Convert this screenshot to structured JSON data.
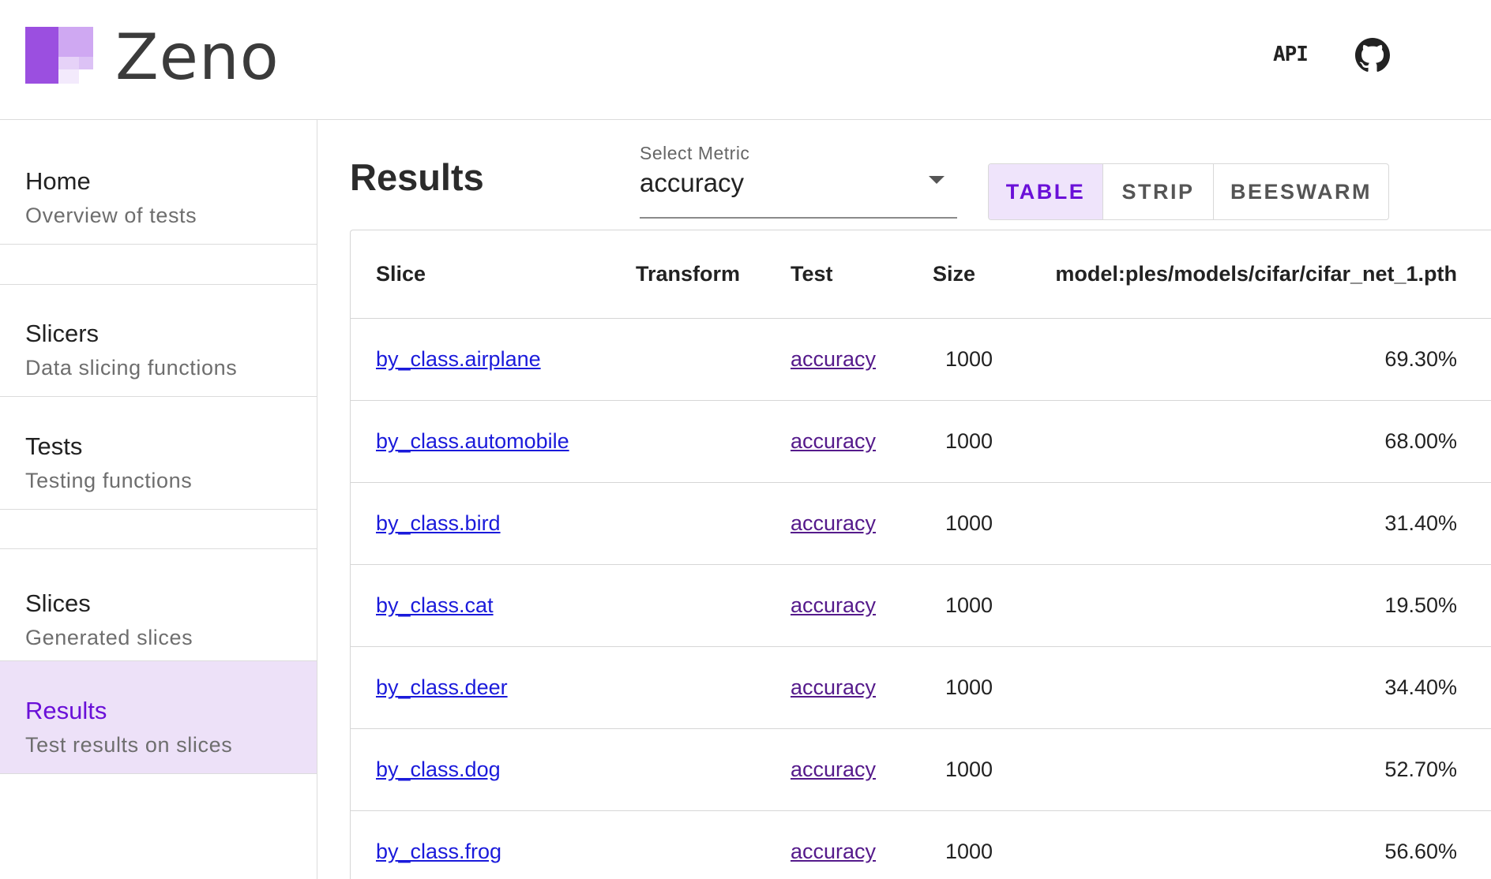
{
  "header": {
    "app_name": "Zeno",
    "api_label": "API",
    "icons": {
      "logo": "zeno-logo",
      "github": "github-icon"
    },
    "colors": {
      "brand": "#9b4fe0",
      "brand_light": "#cfa8f2"
    }
  },
  "sidebar": {
    "items": [
      {
        "title": "Home",
        "subtitle": "Overview of tests",
        "active": false
      },
      {
        "title": "Slicers",
        "subtitle": "Data slicing functions",
        "active": false
      },
      {
        "title": "Tests",
        "subtitle": "Testing functions",
        "active": false
      },
      {
        "title": "Slices",
        "subtitle": "Generated slices",
        "active": false
      },
      {
        "title": "Results",
        "subtitle": "Test results on slices",
        "active": true
      }
    ],
    "colors": {
      "active_bg": "#ede1f8",
      "active_text": "#6a10d8"
    }
  },
  "main": {
    "title": "Results",
    "metric_select": {
      "label": "Select Metric",
      "value": "accuracy"
    },
    "view_tabs": [
      {
        "label": "TABLE",
        "active": true
      },
      {
        "label": "STRIP",
        "active": false
      },
      {
        "label": "BEESWARM",
        "active": false
      }
    ],
    "table": {
      "columns": {
        "slice": "Slice",
        "transform": "Transform",
        "test": "Test",
        "size": "Size",
        "model_prefix": "model",
        "model_rest": ":ples/models/cifar/cifar_net_1.pth"
      },
      "rows": [
        {
          "slice": "by_class.airplane",
          "transform": "",
          "test": "accuracy",
          "size": "1000",
          "value": "69.30%"
        },
        {
          "slice": "by_class.automobile",
          "transform": "",
          "test": "accuracy",
          "size": "1000",
          "value": "68.00%"
        },
        {
          "slice": "by_class.bird",
          "transform": "",
          "test": "accuracy",
          "size": "1000",
          "value": "31.40%"
        },
        {
          "slice": "by_class.cat",
          "transform": "",
          "test": "accuracy",
          "size": "1000",
          "value": "19.50%"
        },
        {
          "slice": "by_class.deer",
          "transform": "",
          "test": "accuracy",
          "size": "1000",
          "value": "34.40%"
        },
        {
          "slice": "by_class.dog",
          "transform": "",
          "test": "accuracy",
          "size": "1000",
          "value": "52.70%"
        },
        {
          "slice": "by_class.frog",
          "transform": "",
          "test": "accuracy",
          "size": "1000",
          "value": "56.60%"
        }
      ]
    }
  }
}
